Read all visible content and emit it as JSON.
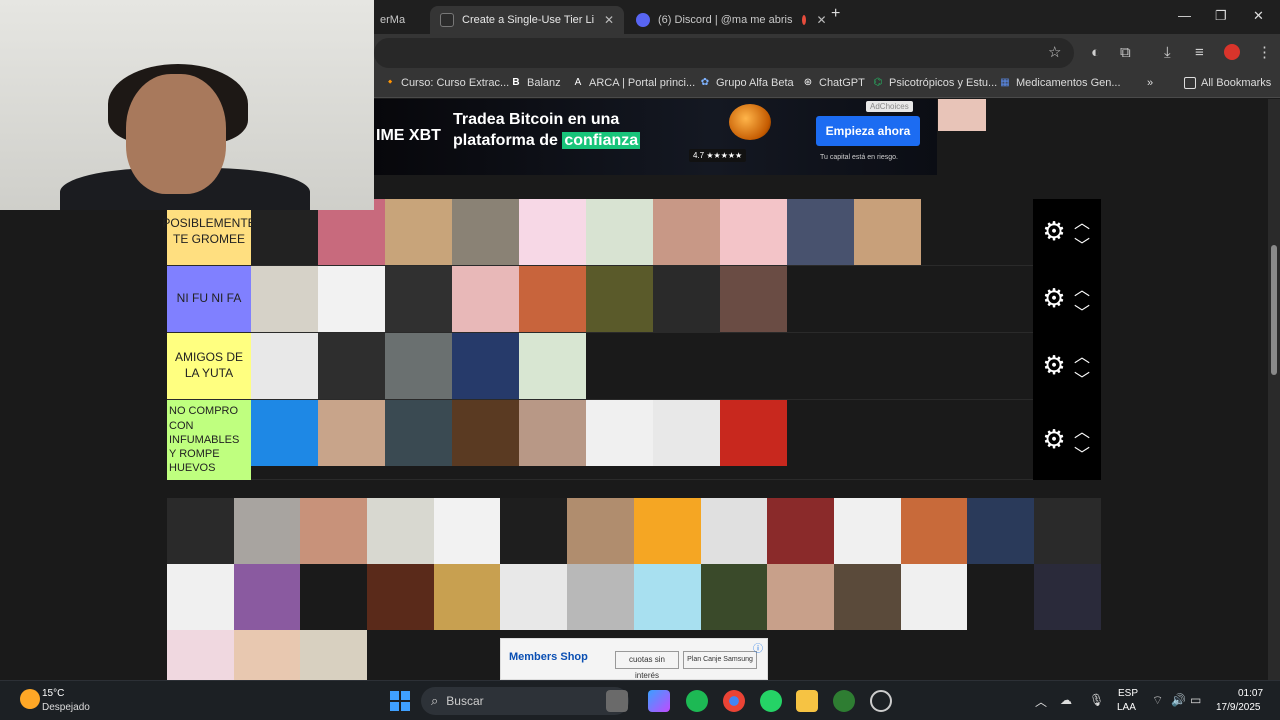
{
  "browser": {
    "tabs": [
      {
        "label": "erMa",
        "favicon_color": "#5f6368"
      },
      {
        "label": "Create a Single-Use Tier List (Pr",
        "favicon_color": "#2b2b2b",
        "active": true
      },
      {
        "label": "(6) Discord | @ma me abris",
        "favicon_color": "#5865f2"
      }
    ],
    "new_tab": "+",
    "window_controls": {
      "minimize": "—",
      "maximize": "❐",
      "close": "✕"
    },
    "toolbar_icons": [
      "star-icon",
      "extension-icon",
      "puzzle-icon",
      "download-icon",
      "media-icon",
      "profile-icon",
      "menu-icon"
    ],
    "bookmarks": [
      {
        "label": "Curso: Curso Extrac...",
        "icon": "🔸"
      },
      {
        "label": "Balanz",
        "icon": "B"
      },
      {
        "label": "ARCA | Portal princi...",
        "icon": "A"
      },
      {
        "label": "Grupo Alfa Beta",
        "icon": "✿"
      },
      {
        "label": "ChatGPT",
        "icon": "⊛"
      },
      {
        "label": "Psicotrópicos y Estu...",
        "icon": "⌬"
      },
      {
        "label": "Medicamentos Gen...",
        "icon": "▦"
      }
    ],
    "bookmarks_more": "»",
    "all_bookmarks": "All Bookmarks"
  },
  "ad_top": {
    "brand": "IME XBT",
    "line1": "Tradea Bitcoin en una",
    "line2_prefix": "plataforma de",
    "line2_highlight": "confianza",
    "cta": "Empieza ahora",
    "rating": "4.7 ★★★★★",
    "disclaimer": "Tu capital está en riesgo.",
    "adchoices": "AdChoices"
  },
  "tiers": [
    {
      "label": "POSIBLEMENTE TE GROMEE",
      "color": "#ffdf80",
      "item_colors": [
        "#222222",
        "#c86a7d",
        "#c8a47a",
        "#8a8275",
        "#f7d8e6",
        "#d8e3d2",
        "#c89886",
        "#f3c4c8",
        "#48526e",
        "#c8a07a"
      ]
    },
    {
      "label": "NI FU NI FA",
      "color": "#8080ff",
      "item_colors": [
        "#d6d2c8",
        "#f2f2f2",
        "#303030",
        "#e8b8b8",
        "#c8643c",
        "#5a5a2a",
        "#2a2a2a",
        "#6a4c44"
      ]
    },
    {
      "label": "AMIGOS DE LA YUTA",
      "color": "#ffff80",
      "item_colors": [
        "#e8e8e8",
        "#2e2e2e",
        "#6a7070",
        "#263a6a",
        "#d8e6d2"
      ]
    },
    {
      "label": "NO COMPRO CON INFUMABLES Y ROMPE HUEVOS",
      "color": "#bfff7f",
      "item_colors": [
        "#1e88e5",
        "#c8a48a",
        "#3a4a52",
        "#5a3a22",
        "#b89886",
        "#f0f0f0",
        "#e8e8e8",
        "#c8281e"
      ]
    }
  ],
  "pool_item_colors": [
    "#2a2a2a",
    "#a8a4a0",
    "#c8927a",
    "#d8d8d0",
    "#f2f2f2",
    "#1e1e1e",
    "#b08d6e",
    "#f5a623",
    "#e0e0e0",
    "#8a2a2a",
    "#f0f0f0",
    "#c86a3a",
    "#2a3a5a",
    "#2a2a2a",
    "#f0f0f0",
    "#8a5aa0",
    "#1a1a1a",
    "#5a2a1a",
    "#c8a050",
    "#e8e8e8",
    "#b8b8b8",
    "#a8e0f0",
    "#3a4a2a",
    "#c8a08a",
    "#5a4a3a",
    "#f0f0f0",
    "#1a1a1a",
    "#2a2a3a",
    "#f0d8e0",
    "#e8c8b0",
    "#d8d0c0"
  ],
  "ad_bottom": {
    "brand": "Members Shop",
    "badge1": "cuotas sin interés",
    "badge2": "Plan Canje Samsung",
    "info_icon": "ⓘ"
  },
  "taskbar": {
    "temp": "15°C",
    "weather": "Despejado",
    "search": "Buscar",
    "lang1": "ESP",
    "lang2": "LAA",
    "time": "01:07",
    "date": "17/9/2025"
  }
}
